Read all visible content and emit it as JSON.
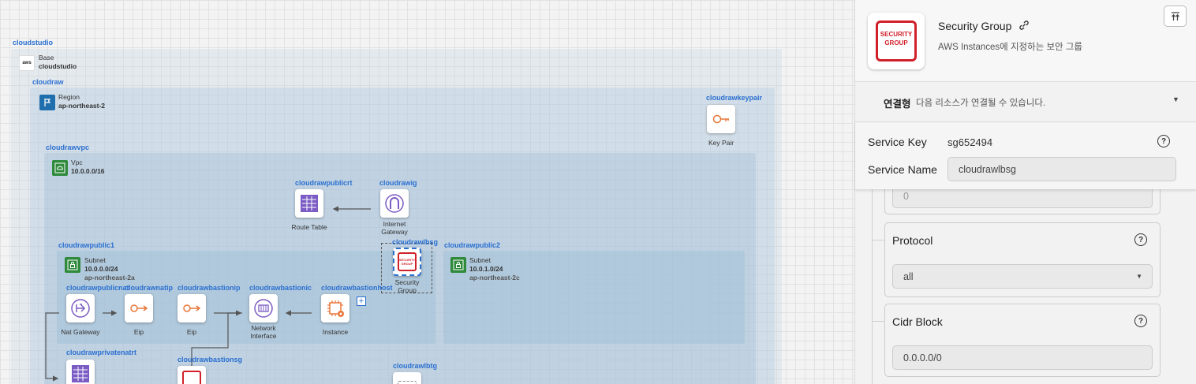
{
  "diagram": {
    "groups": {
      "studio": {
        "name": "cloudstudio",
        "type": "Base",
        "value": "cloudstudio"
      },
      "region": {
        "name": "cloudraw",
        "type": "Region",
        "value": "ap-northeast-2"
      },
      "vpc": {
        "name": "cloudrawvpc",
        "type": "Vpc",
        "value": "10.0.0.0/16"
      },
      "public1": {
        "name": "cloudrawpublic1",
        "type": "Subnet",
        "cidr": "10.0.0.0/24",
        "az": "ap-northeast-2a"
      },
      "public2": {
        "name": "cloudrawpublic2",
        "type": "Subnet",
        "cidr": "10.0.1.0/24",
        "az": "ap-northeast-2c"
      }
    },
    "aws_logo": "aws",
    "nodes": {
      "keypair": {
        "name": "cloudrawkeypair",
        "label": "Key Pair"
      },
      "publicrt": {
        "name": "cloudrawpublicrt",
        "label": "Route Table"
      },
      "igw": {
        "name": "cloudrawig",
        "label1": "Internet",
        "label2": "Gateway"
      },
      "lbsg": {
        "name": "cloudrawlbsg",
        "label1": "Security",
        "label2": "Group",
        "icon_text": "SECURITY GROUP"
      },
      "natgw": {
        "name": "cloudrawpublicnat",
        "label": "Nat Gateway"
      },
      "natip": {
        "name": "cloudrawnatip",
        "label": "Eip"
      },
      "bastionip": {
        "name": "cloudrawbastionip",
        "label": "Eip"
      },
      "bastionic": {
        "name": "cloudrawbastionic",
        "label1": "Network",
        "label2": "Interface"
      },
      "bastionhost": {
        "name": "cloudrawbastionhost",
        "label": "Instance"
      },
      "privatenatrt": {
        "name": "cloudrawprivatenatrt"
      },
      "bastionsg": {
        "name": "cloudrawbastionsg"
      },
      "lbtg": {
        "name": "cloudrawlbtg"
      }
    },
    "add_symbol": "+"
  },
  "panel": {
    "icon_text_1": "SECURITY",
    "icon_text_2": "GROUP",
    "title": "Security Group",
    "link_icon": "link-icon",
    "description": "AWS Instances에 지정하는 보안 그룹",
    "collapse_icon": "collapse-top-icon",
    "connection": {
      "key": "연결형",
      "desc": "다음 리소스가 연결될 수 있습니다.",
      "caret": "▼"
    },
    "service_key_label": "Service Key",
    "service_key_value": "sg652494",
    "service_name_label": "Service Name",
    "service_name_value": "cloudrawlbsg",
    "partial_field_value": "0",
    "protocol": {
      "label": "Protocol",
      "value": "all",
      "caret": "▼"
    },
    "cidr": {
      "label": "Cidr Block",
      "value": "0.0.0.0/0"
    },
    "help": "?"
  },
  "colors": {
    "accent_label": "#2a6fd0",
    "sg_red": "#d0202a",
    "purple": "#7b5cc4",
    "orange": "#e8763a",
    "green": "#2f8a3c"
  }
}
